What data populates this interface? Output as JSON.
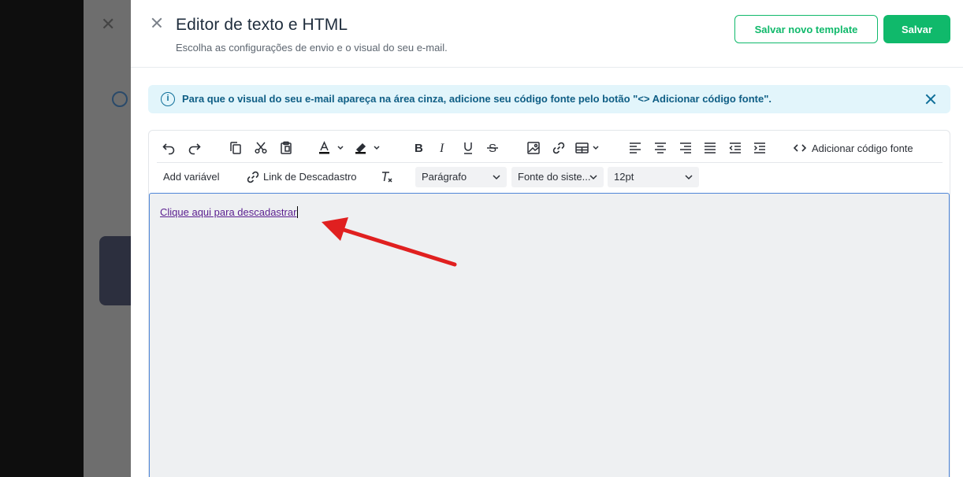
{
  "header": {
    "title": "Editor de texto e HTML",
    "subtitle": "Escolha as configurações de envio e o visual do seu e-mail.",
    "save_template_label": "Salvar novo template",
    "save_label": "Salvar"
  },
  "alert": {
    "text": "Para que o visual do seu e-mail apareça na área cinza, adicione seu código fonte pelo botão \"<> Adicionar código fonte\"."
  },
  "toolbar": {
    "source_code_label": "Adicionar código fonte",
    "add_variable_label": "Add variável",
    "unsubscribe_link_label": "Link de Descadastro",
    "block_format": "Parágrafo",
    "font_family": "Fonte do siste...",
    "font_size": "12pt"
  },
  "editor": {
    "link_text": "Clique aqui para descadastrar"
  },
  "colors": {
    "accent": "#10b96b",
    "alert_bg": "#e2f5fb",
    "alert_text": "#0f5e85",
    "editor_bg": "#eef0f2",
    "link": "#5a1e8f",
    "arrow": "#e02020"
  }
}
